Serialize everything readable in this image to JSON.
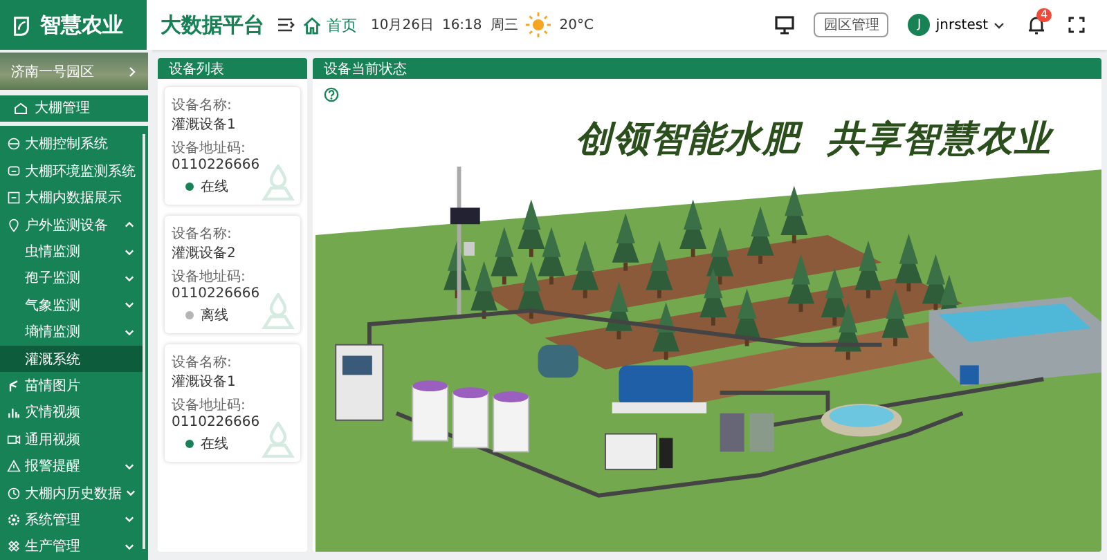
{
  "header": {
    "logo": "智慧农业",
    "title": "大数据平台",
    "home": "首页",
    "date": "10月26日",
    "time": "16:18",
    "weekday": "周三",
    "temperature": "20°C",
    "park_button": "园区管理",
    "avatar": "J",
    "user": "jnrstest",
    "notifications": "4"
  },
  "sidebar": {
    "park": "济南一号园区",
    "section": "大棚管理",
    "items": [
      {
        "label": "大棚控制系统",
        "kind": "page",
        "selected": false
      },
      {
        "label": "大棚环境监测系统",
        "kind": "page",
        "selected": false
      },
      {
        "label": "大棚内数据展示",
        "kind": "page",
        "selected": false
      },
      {
        "label": "户外监测设备",
        "kind": "folder",
        "expanded": true,
        "selected": false,
        "children": [
          {
            "label": "虫情监测",
            "kind": "folder",
            "expanded": false,
            "selected": false
          },
          {
            "label": "孢子监测",
            "kind": "folder",
            "expanded": false,
            "selected": false
          },
          {
            "label": "气象监测",
            "kind": "folder",
            "expanded": false,
            "selected": false
          },
          {
            "label": "墒情监测",
            "kind": "folder",
            "expanded": false,
            "selected": false
          },
          {
            "label": "灌溉系统",
            "kind": "page",
            "selected": true
          }
        ]
      },
      {
        "label": "苗情图片",
        "kind": "page",
        "selected": false
      },
      {
        "label": "灾情视频",
        "kind": "page",
        "selected": false
      },
      {
        "label": "通用视频",
        "kind": "page",
        "selected": false
      },
      {
        "label": "报警提醒",
        "kind": "folder",
        "expanded": false,
        "selected": false
      },
      {
        "label": "大棚内历史数据",
        "kind": "folder",
        "expanded": false,
        "selected": false
      },
      {
        "label": "系统管理",
        "kind": "folder",
        "expanded": false,
        "selected": false
      },
      {
        "label": "生产管理",
        "kind": "folder",
        "expanded": false,
        "selected": false
      }
    ]
  },
  "device_list": {
    "title": "设备列表",
    "devices": [
      {
        "name_label": "设备名称:",
        "name": "灌溉设备1",
        "address_label": "设备地址码:",
        "address": "0110226666",
        "status": "在线",
        "online": true
      },
      {
        "name_label": "设备名称:",
        "name": "灌溉设备2",
        "address_label": "设备地址码:",
        "address": "0110226666",
        "status": "离线",
        "online": false
      },
      {
        "name_label": "设备名称:",
        "name": "灌溉设备1",
        "address_label": "设备地址码:",
        "address": "0110226666",
        "status": "在线",
        "online": true
      }
    ]
  },
  "device_status": {
    "title": "设备当前状态",
    "slogan": "创领智能水肥  共享智慧农业"
  }
}
